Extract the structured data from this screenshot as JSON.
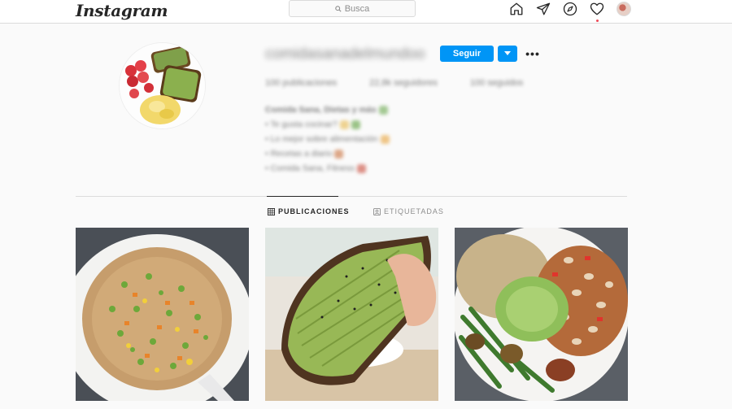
{
  "nav": {
    "logo": "Instagram",
    "search_placeholder": "Busca",
    "icons": [
      "home-icon",
      "direct-icon",
      "explore-icon",
      "activity-icon",
      "profile-avatar"
    ]
  },
  "profile": {
    "username": "comidasanadelmundoo",
    "follow_label": "Seguir",
    "more_label": "•••",
    "stats": {
      "posts": "100 publicaciones",
      "followers": "22,8k seguidores",
      "following": "100 seguidos"
    },
    "bio": {
      "name": "Comida Sana, Dietas y más",
      "lines": [
        "• Te gusta cocinar?",
        "• Lo mejor sobre alimentación",
        "• Recetas a diario",
        "• Comida Sana, Fitness"
      ]
    }
  },
  "tabs": {
    "publications": "PUBLICACIONES",
    "tagged": "ETIQUETADAS"
  },
  "posts": [
    {
      "name": "post-fried-rice"
    },
    {
      "name": "post-avocado-toast"
    },
    {
      "name": "post-bean-bowl"
    }
  ],
  "colors": {
    "accent": "#0095f6",
    "notification": "#ed4956",
    "background": "#fafafa"
  }
}
